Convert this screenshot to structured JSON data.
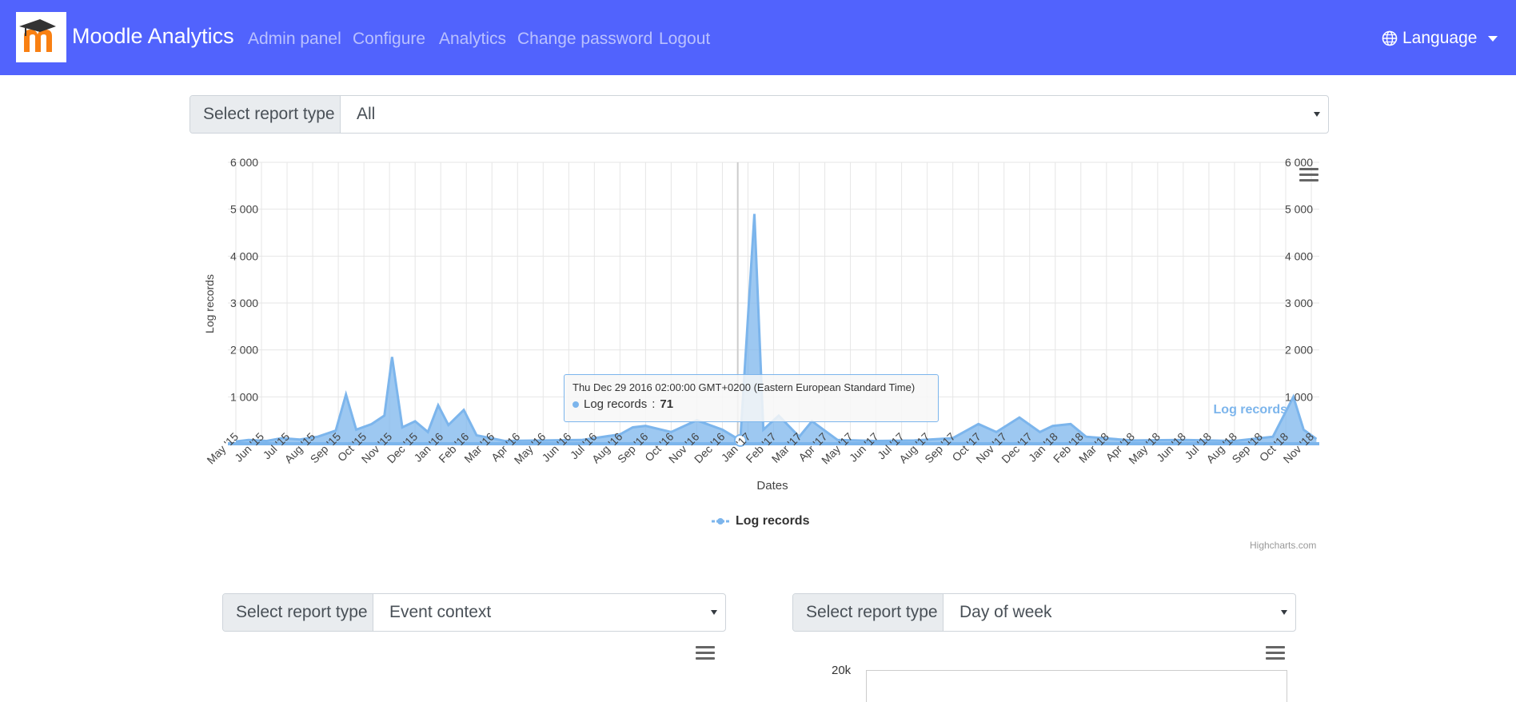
{
  "navbar": {
    "brand": "Moodle Analytics",
    "links": [
      "Admin panel",
      "Configure",
      "Analytics",
      "Change password",
      "Logout"
    ],
    "language": "Language",
    "bg_color": "#5163fd",
    "logo_icon": "moodle-logo-icon",
    "language_icon": "globe-icon"
  },
  "main_select": {
    "label": "Select report type",
    "value": "All"
  },
  "select_left": {
    "label": "Select report type",
    "value": "Event context"
  },
  "select_right": {
    "label": "Select report type",
    "value": "Day of week"
  },
  "chart_data": {
    "type": "area",
    "title": "",
    "xlabel": "Dates",
    "ylabel": "Log records",
    "ylim": [
      0,
      6000
    ],
    "yticks": [
      "1 000",
      "2 000",
      "3 000",
      "4 000",
      "5 000",
      "6 000"
    ],
    "ytick_values": [
      1000,
      2000,
      3000,
      4000,
      5000,
      6000
    ],
    "xticks": [
      "May '15",
      "Jun '15",
      "Jul '15",
      "Aug '15",
      "Sep '15",
      "Oct '15",
      "Nov '15",
      "Dec '15",
      "Jan '16",
      "Feb '16",
      "Mar '16",
      "Apr '16",
      "May '16",
      "Jun '16",
      "Jul '16",
      "Aug '16",
      "Sep '16",
      "Oct '16",
      "Nov '16",
      "Dec '16",
      "Jan '17",
      "Feb '17",
      "Mar '17",
      "Apr '17",
      "May '17",
      "Jun '17",
      "Jul '17",
      "Aug '17",
      "Sep '17",
      "Oct '17",
      "Nov '17",
      "Dec '17",
      "Jan '18",
      "Feb '18",
      "Mar '18",
      "Apr '18",
      "May '18",
      "Jun '18",
      "Jul '18",
      "Aug '18",
      "Sep '18",
      "Oct '18",
      "Nov '18"
    ],
    "series": [
      {
        "name": "Log records",
        "color": "#7cb5ec",
        "points": [
          {
            "month": 0.0,
            "value": 50
          },
          {
            "month": 0.5,
            "value": 80
          },
          {
            "month": 1.2,
            "value": 60
          },
          {
            "month": 1.8,
            "value": 120
          },
          {
            "month": 2.5,
            "value": 90
          },
          {
            "month": 3.2,
            "value": 150
          },
          {
            "month": 3.9,
            "value": 280
          },
          {
            "month": 4.3,
            "value": 1050
          },
          {
            "month": 4.7,
            "value": 300
          },
          {
            "month": 5.3,
            "value": 420
          },
          {
            "month": 5.8,
            "value": 600
          },
          {
            "month": 6.1,
            "value": 1850
          },
          {
            "month": 6.5,
            "value": 350
          },
          {
            "month": 7.0,
            "value": 480
          },
          {
            "month": 7.5,
            "value": 250
          },
          {
            "month": 7.9,
            "value": 820
          },
          {
            "month": 8.3,
            "value": 400
          },
          {
            "month": 8.9,
            "value": 720
          },
          {
            "month": 9.4,
            "value": 180
          },
          {
            "month": 10.5,
            "value": 60
          },
          {
            "month": 12.0,
            "value": 70
          },
          {
            "month": 13.5,
            "value": 80
          },
          {
            "month": 15.0,
            "value": 200
          },
          {
            "month": 15.5,
            "value": 350
          },
          {
            "month": 16.0,
            "value": 380
          },
          {
            "month": 17.0,
            "value": 250
          },
          {
            "month": 18.0,
            "value": 500
          },
          {
            "month": 19.0,
            "value": 300
          },
          {
            "month": 19.7,
            "value": 71
          },
          {
            "month": 20.25,
            "value": 4900
          },
          {
            "month": 20.6,
            "value": 300
          },
          {
            "month": 21.2,
            "value": 600
          },
          {
            "month": 22.0,
            "value": 150
          },
          {
            "month": 22.5,
            "value": 480
          },
          {
            "month": 23.5,
            "value": 80
          },
          {
            "month": 25.0,
            "value": 60
          },
          {
            "month": 26.5,
            "value": 70
          },
          {
            "month": 28.0,
            "value": 120
          },
          {
            "month": 29.0,
            "value": 420
          },
          {
            "month": 29.7,
            "value": 250
          },
          {
            "month": 30.6,
            "value": 560
          },
          {
            "month": 31.4,
            "value": 250
          },
          {
            "month": 31.9,
            "value": 380
          },
          {
            "month": 32.6,
            "value": 420
          },
          {
            "month": 33.2,
            "value": 150
          },
          {
            "month": 35.0,
            "value": 70
          },
          {
            "month": 37.0,
            "value": 80
          },
          {
            "month": 39.0,
            "value": 60
          },
          {
            "month": 40.5,
            "value": 150
          },
          {
            "month": 41.3,
            "value": 1000
          },
          {
            "month": 41.7,
            "value": 300
          },
          {
            "month": 42.2,
            "value": 100
          }
        ]
      }
    ],
    "legend": "bottom-center",
    "credits": "Highcharts.com",
    "grid": true,
    "tooltip": {
      "header": "Thu Dec 29 2016 02:00:00 GMT+0200 (Eastern European Standard Time)",
      "series": "Log records",
      "value": "71"
    },
    "series_label": "Log records"
  },
  "small_chart": {
    "ytick": "20k"
  },
  "icons": {
    "chart_menu": "hamburger-menu-icon"
  }
}
